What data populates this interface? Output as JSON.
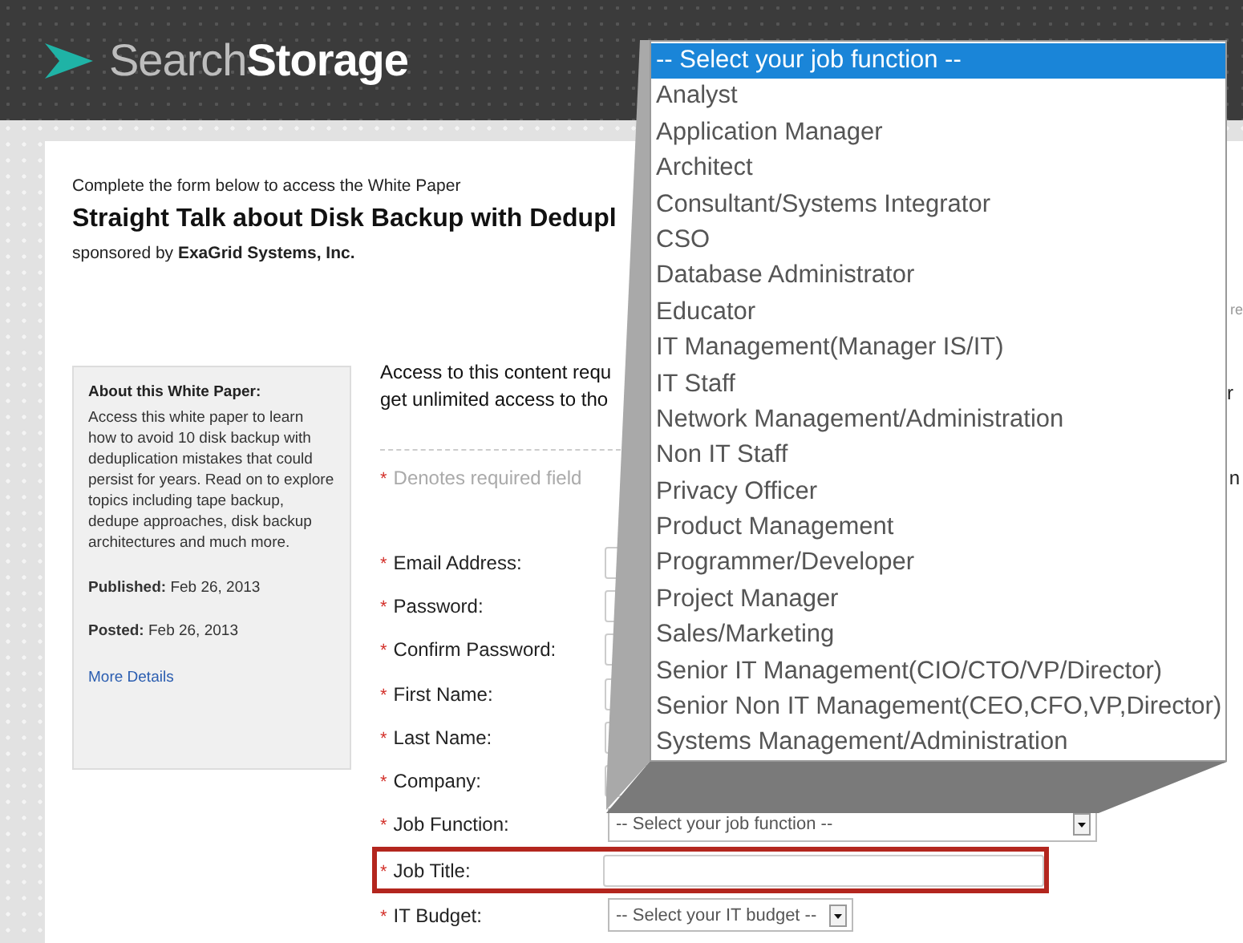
{
  "header": {
    "logo": "Search**Storage**"
  },
  "intro": "Complete the form below to access the White Paper",
  "title": "Straight Talk about Disk Backup with Dedupl",
  "sponsor": "sponsored by **ExaGrid Systems, Inc.**",
  "sidebar": {
    "heading": "About this White Paper:",
    "body": "Access this white paper to learn how to avoid 10 disk backup with deduplication mistakes that could persist for years. Read on to explore topics including tape backup, dedupe approaches, disk backup architectures and much more.",
    "meta": [
      "**Published:** Feb 26, 2013",
      "**Posted:** Feb 26, 2013"
    ],
    "link": "More Details"
  },
  "access_text": [
    "Access to this content requ",
    "get unlimited access to tho"
  ],
  "edge_fragments": [
    "re",
    "r",
    "n"
  ],
  "required_note": {
    "mark": "*",
    "text": "Denotes required field"
  },
  "fields": [
    {
      "label": "Email Address:",
      "required": true,
      "kind": "text",
      "highlighted": false
    },
    {
      "label": "Password:",
      "required": true,
      "kind": "text",
      "highlighted": false
    },
    {
      "label": "Confirm Password:",
      "required": true,
      "kind": "text",
      "highlighted": false
    },
    {
      "label": "First Name:",
      "required": true,
      "kind": "text",
      "highlighted": false
    },
    {
      "label": "Last Name:",
      "required": true,
      "kind": "text",
      "highlighted": false
    },
    {
      "label": "Company:",
      "required": true,
      "kind": "text",
      "highlighted": false
    },
    {
      "label": "Job Function:",
      "required": true,
      "kind": "select",
      "value": "-- Select your job function --",
      "highlighted": false
    },
    {
      "label": "Job Title:",
      "required": true,
      "kind": "text",
      "highlighted": true
    },
    {
      "label": "IT Budget:",
      "required": true,
      "kind": "select",
      "value": "-- Select your IT budget --",
      "highlighted": false
    }
  ],
  "dropdown_options": [
    {
      "label": "-- Select your job function --",
      "selected": true
    },
    {
      "label": "Analyst",
      "selected": false
    },
    {
      "label": "Application Manager",
      "selected": false
    },
    {
      "label": "Architect",
      "selected": false
    },
    {
      "label": "Consultant/Systems Integrator",
      "selected": false
    },
    {
      "label": "CSO",
      "selected": false
    },
    {
      "label": "Database Administrator",
      "selected": false
    },
    {
      "label": "Educator",
      "selected": false
    },
    {
      "label": "IT Management(Manager IS/IT)",
      "selected": false
    },
    {
      "label": "IT Staff",
      "selected": false
    },
    {
      "label": "Network Management/Administration",
      "selected": false
    },
    {
      "label": "Non IT Staff",
      "selected": false
    },
    {
      "label": "Privacy Officer",
      "selected": false
    },
    {
      "label": "Product Management",
      "selected": false
    },
    {
      "label": "Programmer/Developer",
      "selected": false
    },
    {
      "label": "Project Manager",
      "selected": false
    },
    {
      "label": "Sales/Marketing",
      "selected": false
    },
    {
      "label": "Senior IT Management(CIO/CTO/VP/Director)",
      "selected": false
    },
    {
      "label": "Senior Non IT Management(CEO,CFO,VP,Director)",
      "selected": false
    },
    {
      "label": "Systems Management/Administration",
      "selected": false
    }
  ]
}
